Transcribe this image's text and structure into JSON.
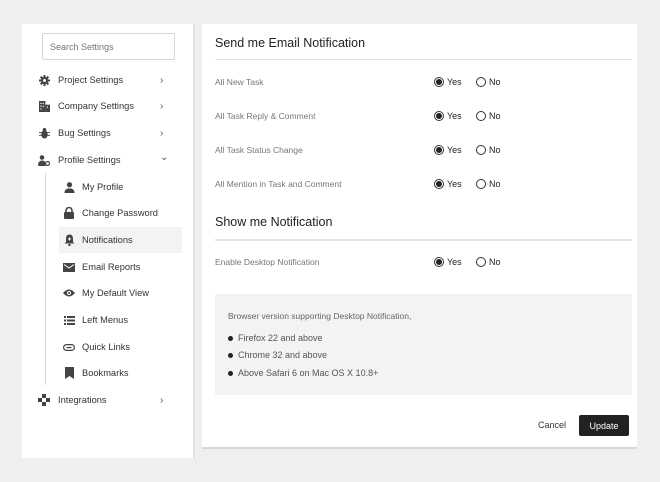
{
  "sidebar": {
    "search_placeholder": "Search Settings",
    "items": [
      {
        "label": "Project Settings",
        "icon": "gear-icon"
      },
      {
        "label": "Company Settings",
        "icon": "building-icon"
      },
      {
        "label": "Bug Settings",
        "icon": "bug-icon"
      },
      {
        "label": "Profile Settings",
        "icon": "user-gear-icon"
      },
      {
        "label": "Integrations",
        "icon": "integrations-icon"
      }
    ],
    "chevron_right": "›",
    "chevron_down": "⌄",
    "sub_items": [
      {
        "label": "My Profile",
        "icon": "user-icon"
      },
      {
        "label": "Change Password",
        "icon": "lock-icon"
      },
      {
        "label": "Notifications",
        "icon": "bell-icon"
      },
      {
        "label": "Email Reports",
        "icon": "envelope-icon"
      },
      {
        "label": "My Default View",
        "icon": "eye-icon"
      },
      {
        "label": "Left Menus",
        "icon": "list-icon"
      },
      {
        "label": "Quick Links",
        "icon": "link-icon"
      },
      {
        "label": "Bookmarks",
        "icon": "bookmark-icon"
      }
    ]
  },
  "main": {
    "email_title": "Send me Email Notification",
    "email_rows": [
      {
        "label": "All New Task",
        "value": "Yes"
      },
      {
        "label": "All Task Reply & Comment",
        "value": "Yes"
      },
      {
        "label": "All Task Status Change",
        "value": "Yes"
      },
      {
        "label": "All Mention in Task and Comment",
        "value": "Yes"
      }
    ],
    "show_title": "Show me Notification",
    "show_rows": [
      {
        "label": "Enable Desktop Notification",
        "value": "Yes"
      }
    ],
    "yes_label": "Yes",
    "no_label": "No",
    "info": {
      "title": "Browser version supporting Desktop Notification,",
      "items": [
        "Firefox 22 and above",
        "Chrome 32 and above",
        "Above Safari 6 on Mac OS X 10.8+"
      ]
    },
    "cancel_label": "Cancel",
    "update_label": "Update"
  }
}
